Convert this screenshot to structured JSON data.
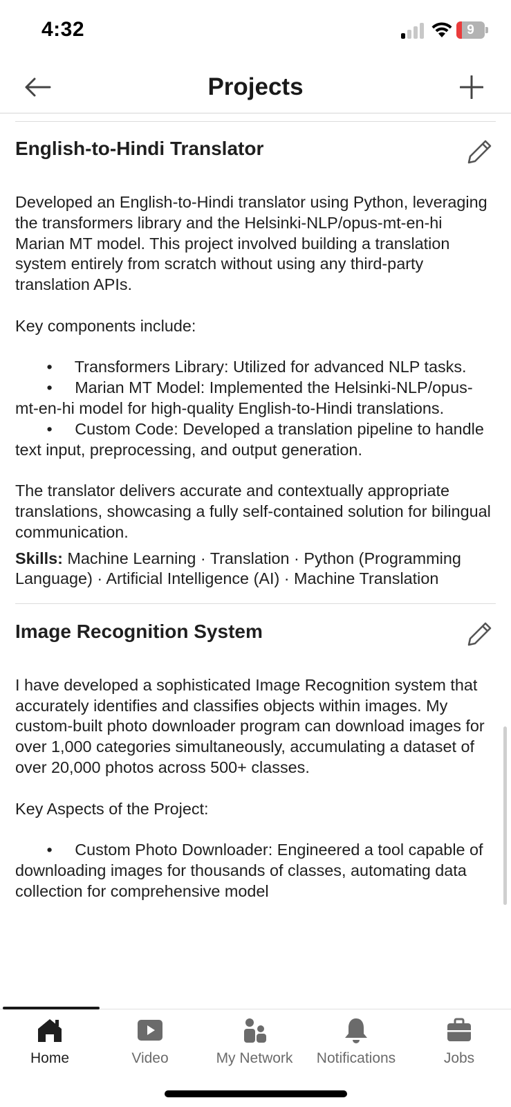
{
  "status_bar": {
    "time": "4:32",
    "battery": "9",
    "battery_level_percent": 9
  },
  "header": {
    "title": "Projects"
  },
  "projects": [
    {
      "title": "English-to-Hindi Translator",
      "desc_intro": "Developed an English-to-Hindi translator using Python, leveraging the transformers library and the Helsinki-NLP/opus-mt-en-hi Marian MT model. This project involved building a translation system entirely from scratch without using any third-party translation APIs.",
      "key_heading": "Key components include:",
      "bullets": [
        "Transformers Library: Utilized for advanced NLP tasks.",
        "Marian MT Model: Implemented the Helsinki-NLP/opus-mt-en-hi model for high-quality English-to-Hindi translations.",
        "Custom Code: Developed a translation pipeline to handle text input, preprocessing, and output generation."
      ],
      "desc_outro": "The translator delivers accurate and contextually appropriate translations, showcasing a fully self-contained solution for bilingual communication.",
      "skills_label": "Skills:",
      "skills": "Machine Learning · Translation · Python (Programming Language) · Artificial Intelligence (AI) · Machine Translation"
    },
    {
      "title": "Image Recognition System",
      "desc_intro": "I have developed a sophisticated Image Recognition system that accurately identifies and classifies objects within images. My custom-built photo downloader program can download images for over 1,000 categories simultaneously, accumulating a dataset of over 20,000 photos across 500+ classes.",
      "key_heading": "Key Aspects of the Project:",
      "bullets": [
        "Custom Photo Downloader: Engineered a tool capable of downloading images for thousands of classes, automating data collection for comprehensive model"
      ]
    }
  ],
  "bottom_nav": [
    {
      "label": "Home",
      "icon": "home-icon",
      "active": true
    },
    {
      "label": "Video",
      "icon": "video-icon",
      "active": false
    },
    {
      "label": "My Network",
      "icon": "network-icon",
      "active": false
    },
    {
      "label": "Notifications",
      "icon": "bell-icon",
      "active": false
    },
    {
      "label": "Jobs",
      "icon": "briefcase-icon",
      "active": false
    }
  ],
  "colors": {
    "text": "#1f1f1f",
    "muted": "#6b6b6b",
    "divider": "#dcdcdc",
    "battery_low": "#ea3b3b"
  }
}
